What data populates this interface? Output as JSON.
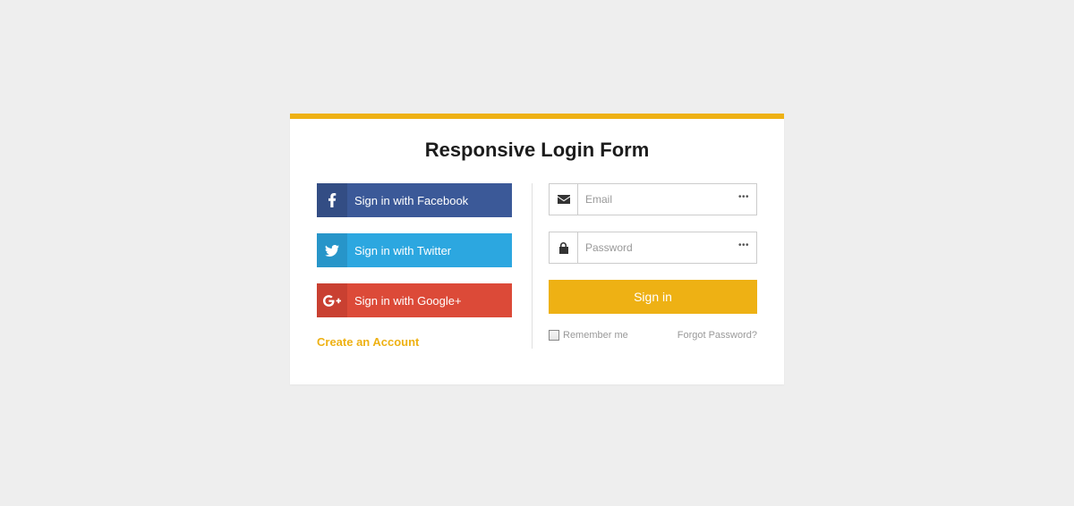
{
  "title": "Responsive Login Form",
  "social": {
    "facebook": "Sign in with Facebook",
    "twitter": "Sign in with Twitter",
    "google": "Sign in with Google+"
  },
  "inputs": {
    "email_placeholder": "Email",
    "password_placeholder": "Password"
  },
  "buttons": {
    "signin": "Sign in",
    "create_account": "Create an Account"
  },
  "footer": {
    "remember": "Remember me",
    "forgot": "Forgot Password?"
  }
}
